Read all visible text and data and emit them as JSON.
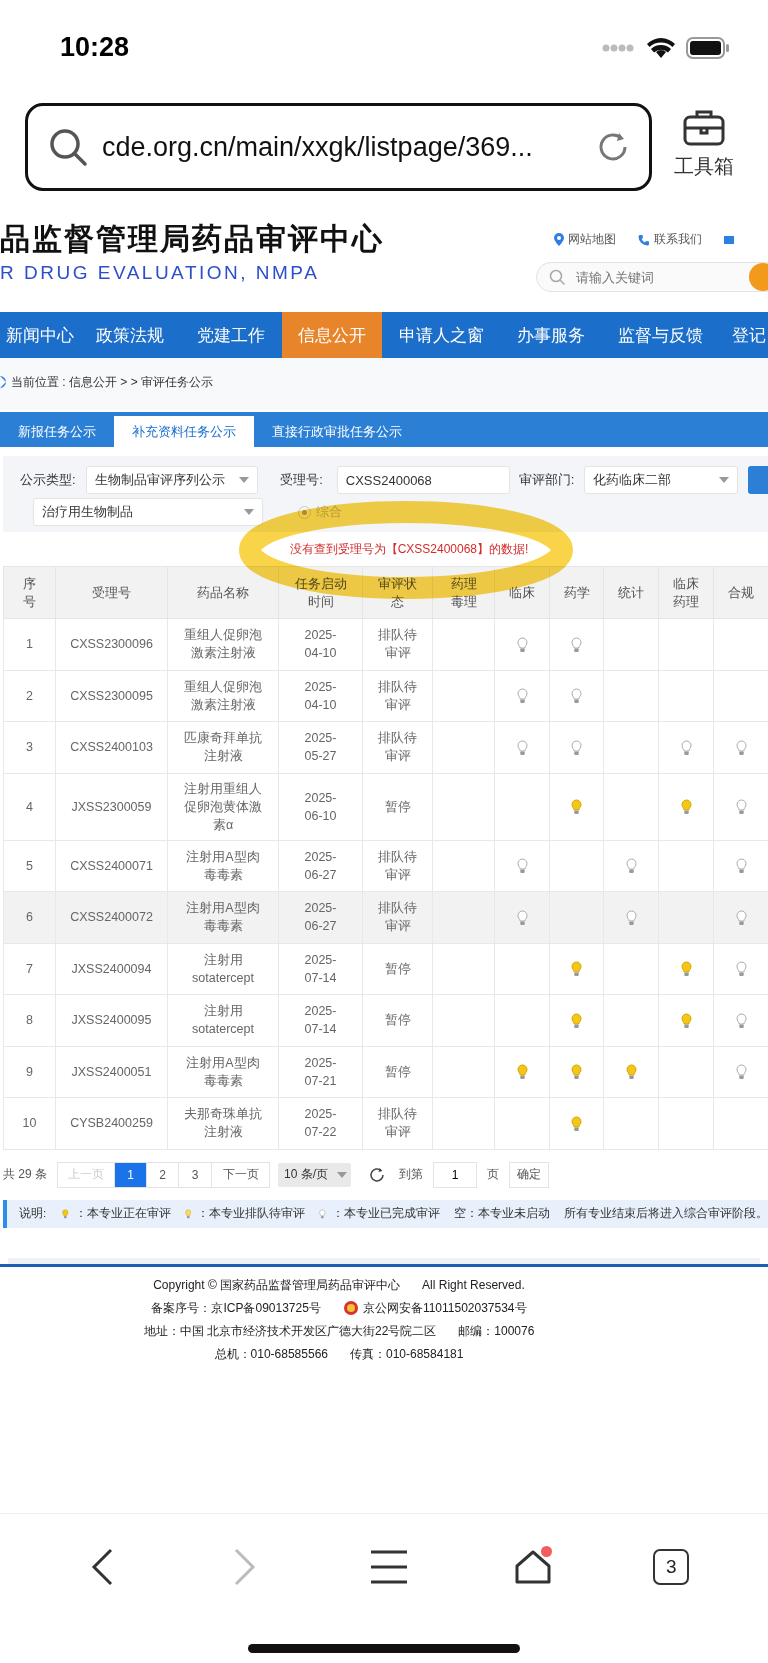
{
  "status_bar": {
    "time": "10:28"
  },
  "browser": {
    "url": "cde.org.cn/main/xxgk/listpage/369...",
    "toolbox_label": "工具箱",
    "tab_count": "3",
    "home_badge": true,
    "forward_disabled": true
  },
  "site_header": {
    "title": "品监督管理局药品审评中心",
    "subtitle": "R DRUG EVALUATION, NMPA",
    "links": [
      "网站地图",
      "联系我们"
    ],
    "search_placeholder": "请输入关键词"
  },
  "nav": [
    {
      "label": "新闻中心",
      "selected": false
    },
    {
      "label": "政策法规",
      "selected": false
    },
    {
      "label": "党建工作",
      "selected": false
    },
    {
      "label": "信息公开",
      "selected": true
    },
    {
      "label": "申请人之窗",
      "selected": false
    },
    {
      "label": "办事服务",
      "selected": false
    },
    {
      "label": "监督与反馈",
      "selected": false
    },
    {
      "label": "登记",
      "selected": false
    }
  ],
  "breadcrumb": "当前位置 : 信息公开 > > 审评任务公示",
  "tabs": [
    {
      "label": "新报任务公示",
      "selected": false
    },
    {
      "label": "补充资料任务公示",
      "selected": true
    },
    {
      "label": "直接行政审批任务公示",
      "selected": false
    }
  ],
  "filters": {
    "type_label": "公示类型:",
    "type_value": "生物制品审评序列公示",
    "number_label": "受理号:",
    "number_value": "CXSS2400068",
    "dept_label": "审评部门:",
    "dept_value": "化药临床二部",
    "category_value": "治疗用生物制品",
    "radio": {
      "label": "综合",
      "selected": true,
      "disabled": true
    }
  },
  "message": "没有查到受理号为【CXSS2400068】的数据!",
  "highlight": {
    "kind": "ring"
  },
  "table": {
    "columns": [
      "序号",
      "受理号",
      "药品名称",
      "任务启动时间",
      "审评状态",
      "药理毒理",
      "临床",
      "药学",
      "统计",
      "临床药理",
      "合规"
    ],
    "rows": [
      {
        "cells": [
          "1",
          "CXSS2300096",
          "重组人促卵泡激素注射液",
          "2025-04-10",
          "排队待审评"
        ],
        "lamps": [
          {
            "on": false
          },
          {
            "on": true,
            "lit": false
          },
          {
            "on": true,
            "lit": false
          },
          {
            "on": false
          },
          {
            "on": false
          },
          {
            "on": false
          }
        ],
        "highlighted": false
      },
      {
        "cells": [
          "2",
          "CXSS2300095",
          "重组人促卵泡激素注射液",
          "2025-04-10",
          "排队待审评"
        ],
        "lamps": [
          {
            "on": false
          },
          {
            "on": true,
            "lit": false
          },
          {
            "on": true,
            "lit": false
          },
          {
            "on": false
          },
          {
            "on": false
          },
          {
            "on": false
          }
        ],
        "highlighted": false
      },
      {
        "cells": [
          "3",
          "CXSS2400103",
          "匹康奇拜单抗注射液",
          "2025-05-27",
          "排队待审评"
        ],
        "lamps": [
          {
            "on": false
          },
          {
            "on": true,
            "lit": false
          },
          {
            "on": true,
            "lit": false
          },
          {
            "on": false
          },
          {
            "on": true,
            "lit": false
          },
          {
            "on": true,
            "lit": false
          }
        ],
        "highlighted": false
      },
      {
        "cells": [
          "4",
          "JXSS2300059",
          "注射用重组人促卵泡黄体激素α",
          "2025-06-10",
          "暂停"
        ],
        "lamps": [
          {
            "on": false
          },
          {
            "on": false
          },
          {
            "on": true,
            "lit": true
          },
          {
            "on": false
          },
          {
            "on": true,
            "lit": true
          },
          {
            "on": true,
            "lit": false
          }
        ],
        "highlighted": false
      },
      {
        "cells": [
          "5",
          "CXSS2400071",
          "注射用A型肉毒毒素",
          "2025-06-27",
          "排队待审评"
        ],
        "lamps": [
          {
            "on": false
          },
          {
            "on": true,
            "lit": false
          },
          {
            "on": false
          },
          {
            "on": true,
            "lit": false
          },
          {
            "on": false
          },
          {
            "on": true,
            "lit": false
          }
        ],
        "highlighted": false
      },
      {
        "cells": [
          "6",
          "CXSS2400072",
          "注射用A型肉毒毒素",
          "2025-06-27",
          "排队待审评"
        ],
        "lamps": [
          {
            "on": false
          },
          {
            "on": true,
            "lit": false
          },
          {
            "on": false
          },
          {
            "on": true,
            "lit": false
          },
          {
            "on": false
          },
          {
            "on": true,
            "lit": false
          }
        ],
        "highlighted": true
      },
      {
        "cells": [
          "7",
          "JXSS2400094",
          "注射用sotatercept",
          "2025-07-14",
          "暂停"
        ],
        "lamps": [
          {
            "on": false
          },
          {
            "on": false
          },
          {
            "on": true,
            "lit": true
          },
          {
            "on": false
          },
          {
            "on": true,
            "lit": true
          },
          {
            "on": true,
            "lit": false
          }
        ],
        "highlighted": false
      },
      {
        "cells": [
          "8",
          "JXSS2400095",
          "注射用sotatercept",
          "2025-07-14",
          "暂停"
        ],
        "lamps": [
          {
            "on": false
          },
          {
            "on": false
          },
          {
            "on": true,
            "lit": true
          },
          {
            "on": false
          },
          {
            "on": true,
            "lit": true
          },
          {
            "on": true,
            "lit": false
          }
        ],
        "highlighted": false
      },
      {
        "cells": [
          "9",
          "JXSS2400051",
          "注射用A型肉毒毒素",
          "2025-07-21",
          "暂停"
        ],
        "lamps": [
          {
            "on": false
          },
          {
            "on": true,
            "lit": true
          },
          {
            "on": true,
            "lit": true
          },
          {
            "on": true,
            "lit": true
          },
          {
            "on": false
          },
          {
            "on": true,
            "lit": false
          }
        ],
        "highlighted": false
      },
      {
        "cells": [
          "10",
          "CYSB2400259",
          "夫那奇珠单抗注射液",
          "2025-07-22",
          "排队待审评"
        ],
        "lamps": [
          {
            "on": false
          },
          {
            "on": false
          },
          {
            "on": true,
            "lit": true
          },
          {
            "on": false
          },
          {
            "on": false
          },
          {
            "on": false
          }
        ],
        "highlighted": false
      }
    ]
  },
  "pagination": {
    "total": "共 29 条",
    "prev": {
      "label": "上一页",
      "disabled": true
    },
    "pages": [
      {
        "label": "1",
        "selected": true
      },
      {
        "label": "2",
        "selected": false
      },
      {
        "label": "3",
        "selected": false
      }
    ],
    "next": "下一页",
    "page_size": "10 条/页",
    "goto_label": "到第",
    "goto_value": "1",
    "page_unit": "页",
    "confirm": "确定"
  },
  "legend": {
    "label": "说明:",
    "items": [
      {
        "kind": "reviewing",
        "text": "：本专业正在审评"
      },
      {
        "kind": "queued",
        "text": "：本专业排队待审评"
      },
      {
        "kind": "done",
        "text": "：本专业已完成审评"
      },
      {
        "kind": "blank",
        "text": "空：本专业未启动"
      }
    ],
    "note": "所有专业结束后将进入综合审评阶段。"
  },
  "footer": [
    [
      {
        "text": "Copyright © 国家药品监督管理局药品审评中心",
        "kind": "plain"
      },
      {
        "text": "All Right Reserved.",
        "kind": "plain"
      }
    ],
    [
      {
        "text": "备案序号：京ICP备09013725号",
        "kind": "plain"
      },
      {
        "text": "京公网安备11011502037534号",
        "kind": "police"
      }
    ],
    [
      {
        "text": "地址：中国 北京市经济技术开发区广德大街22号院二区",
        "kind": "plain"
      },
      {
        "text": "邮编：100076",
        "kind": "plain"
      }
    ],
    [
      {
        "text": "总机：010-68585566",
        "kind": "plain"
      },
      {
        "text": "传真：010-68584181",
        "kind": "plain"
      }
    ]
  ]
}
